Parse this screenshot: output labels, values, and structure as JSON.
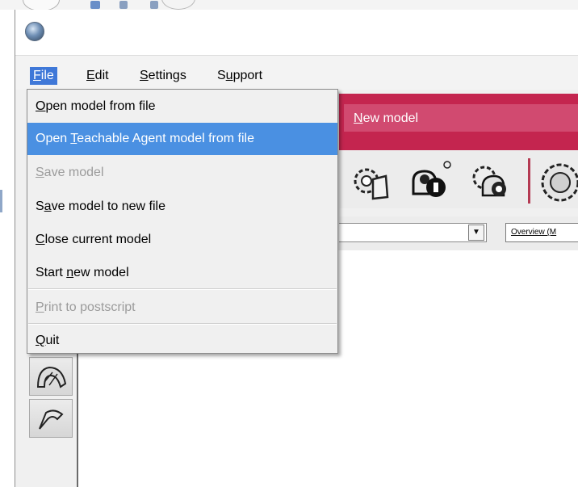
{
  "menubar": {
    "items": [
      {
        "pre": "",
        "u": "F",
        "post": "ile"
      },
      {
        "pre": "",
        "u": "E",
        "post": "dit"
      },
      {
        "pre": "",
        "u": "S",
        "post": "ettings"
      },
      {
        "pre": "S",
        "u": "u",
        "post": "pport"
      }
    ]
  },
  "file_menu": {
    "items": [
      {
        "pre": "",
        "u": "O",
        "post": "pen model from file",
        "state": "normal"
      },
      {
        "pre": "Open ",
        "u": "T",
        "post": "eachable Agent model from file",
        "state": "highlighted"
      },
      {
        "pre": "",
        "u": "S",
        "post": "ave model",
        "state": "disabled"
      },
      {
        "pre": "S",
        "u": "a",
        "post": "ve model to new file",
        "state": "normal"
      },
      {
        "pre": "",
        "u": "C",
        "post": "lose current model",
        "state": "normal"
      },
      {
        "pre": "Start ",
        "u": "n",
        "post": "ew model",
        "state": "normal"
      },
      {
        "pre": "",
        "u": "P",
        "post": "rint to postscript",
        "state": "disabled"
      },
      {
        "pre": "",
        "u": "Q",
        "post": "uit",
        "state": "normal"
      }
    ]
  },
  "tab": {
    "pre": "",
    "u": "N",
    "post": "ew model"
  },
  "view_selector": {
    "label": "Overview (M"
  },
  "colors": {
    "accent_bar": "#c4254f",
    "menu_highlight": "#4a90e2",
    "menubar_active": "#3f78d8"
  },
  "icons": {
    "app": "globe-icon",
    "toolbar": [
      "gear-open-icon",
      "agent-info-icon",
      "gear-agent-icon",
      "globe-gear-icon"
    ],
    "side": [
      "shell-tool-icon",
      "flag-tool-icon"
    ]
  }
}
